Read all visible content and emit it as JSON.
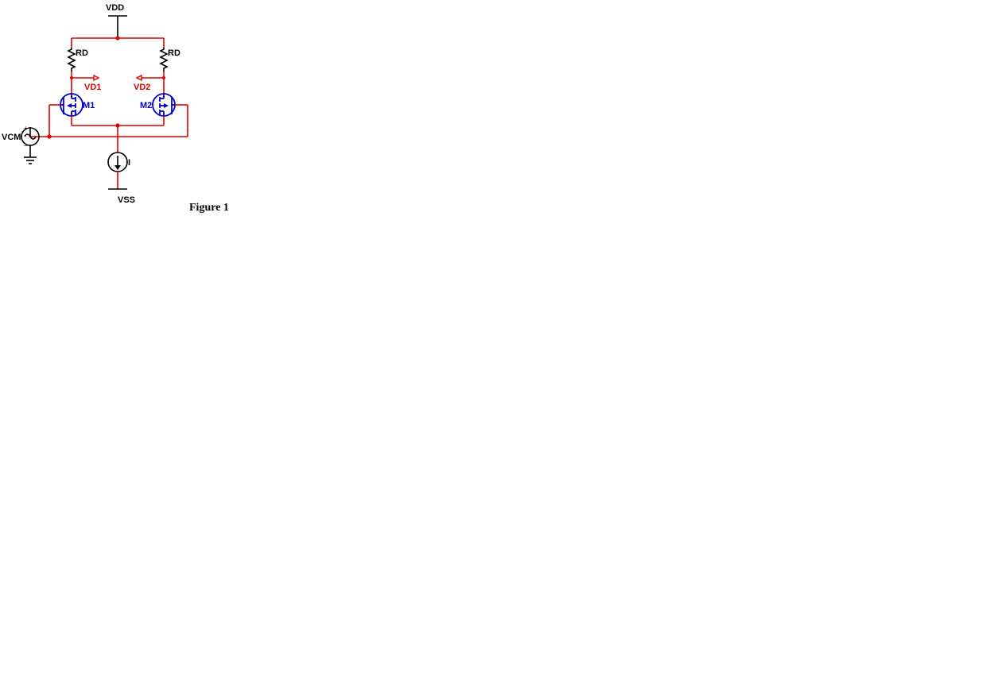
{
  "labels": {
    "vdd": "VDD",
    "vss": "VSS",
    "rd_left": "RD",
    "rd_right": "RD",
    "vd1": "VD1",
    "vd2": "VD2",
    "m1": "M1",
    "m2": "M2",
    "vcm": "VCM",
    "isrc": "I",
    "caption": "Figure 1"
  },
  "colors": {
    "wire": "#e00000",
    "transistor": "#0000cc",
    "text_black": "#000000"
  },
  "circuit": {
    "type": "differential-pair",
    "top_rail": "VDD",
    "bottom_rail": "VSS",
    "left_branch": {
      "load": "RD",
      "node": "VD1",
      "device": "M1 (NMOS)"
    },
    "right_branch": {
      "load": "RD",
      "node": "VD2",
      "device": "M2 (NMOS)"
    },
    "tail": "current source I to VSS",
    "input": "VCM (AC source to ground) drives both gates"
  }
}
